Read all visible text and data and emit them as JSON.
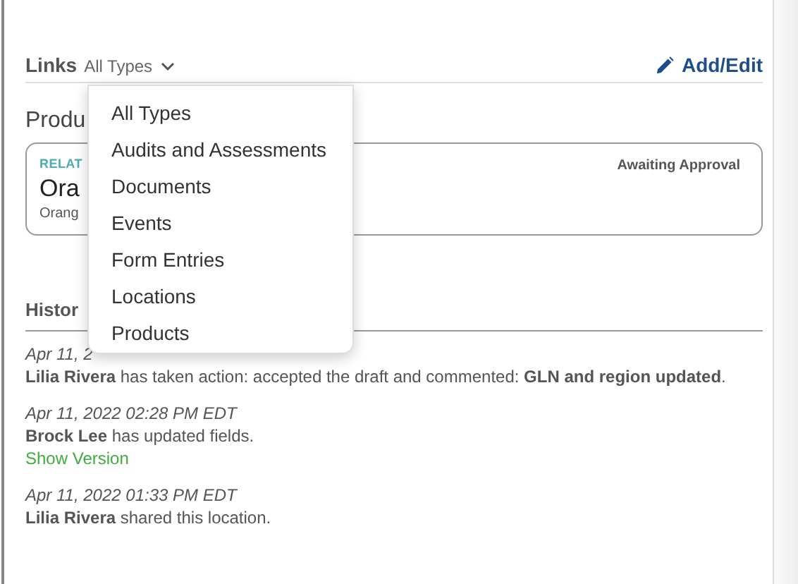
{
  "links": {
    "title": "Links",
    "filter": "All Types",
    "action": "Add/Edit"
  },
  "product_section": {
    "title": "Produ",
    "card": {
      "label": "RELAT",
      "name": "Ora",
      "subtitle": "Orang",
      "status": "Awaiting Approval"
    }
  },
  "history": {
    "title": "Histor",
    "entries": [
      {
        "date": "Apr 11, 2",
        "text": "**Lilia Rivera** has taken action: accepted the draft and commented: **GLN and region updated**."
      },
      {
        "date": "Apr 11, 2022 02:28 PM EDT",
        "text": "**Brock Lee** has updated fields.",
        "link": "Show Version"
      },
      {
        "date": "Apr 11, 2022 01:33 PM EDT",
        "text": "**Lilia Rivera** shared this location."
      }
    ]
  },
  "dropdown": {
    "items": [
      "All Types",
      "Audits and Assessments",
      "Documents",
      "Events",
      "Form Entries",
      "Locations",
      "Products"
    ]
  }
}
